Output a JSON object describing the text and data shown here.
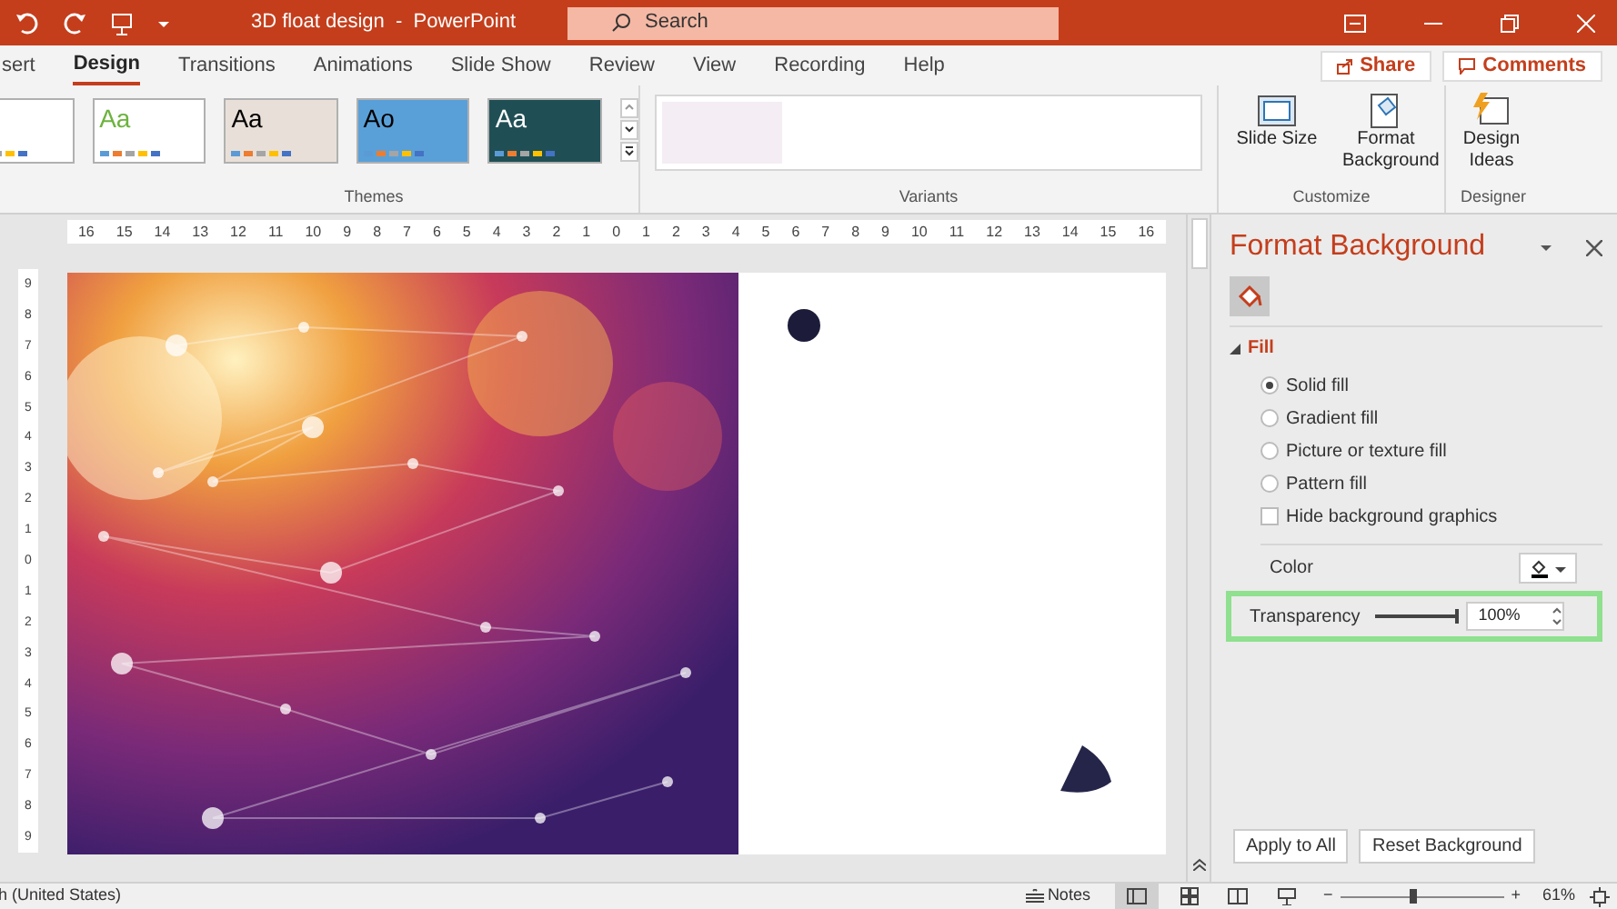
{
  "title_bar": {
    "title": "3D float design  -  PowerPoint",
    "search": {
      "placeholder": "Search"
    }
  },
  "tabs": [
    {
      "label": "sert",
      "selected": false
    },
    {
      "label": "Design",
      "selected": true
    },
    {
      "label": "Transitions",
      "selected": false
    },
    {
      "label": "Animations",
      "selected": false
    },
    {
      "label": "Slide Show",
      "selected": false
    },
    {
      "label": "Review",
      "selected": false
    },
    {
      "label": "View",
      "selected": false
    },
    {
      "label": "Recording",
      "selected": false
    },
    {
      "label": "Help",
      "selected": false
    }
  ],
  "share_button": "Share",
  "comments_button": "Comments",
  "themes": {
    "label": "Themes",
    "items": [
      {
        "color": "#ffffff",
        "selected": false
      },
      {
        "sample": "Aa",
        "color": "#ffffff",
        "selected": false
      },
      {
        "sample": "Aa",
        "color": "#e8e0d8",
        "selected": false
      },
      {
        "sample": "Ao",
        "color": "#5aa0d8",
        "selected": false
      },
      {
        "sample": "Aa",
        "color": "#1f4f55",
        "selected": false
      }
    ]
  },
  "variants": {
    "label": "Variants"
  },
  "customize": {
    "label": "Customize",
    "buttons": [
      "Slide Size",
      "Format Background"
    ]
  },
  "designer": {
    "label": "Designer",
    "buttons": [
      "Design Ideas"
    ]
  },
  "ruler": [
    "16",
    "15",
    "14",
    "13",
    "12",
    "11",
    "10",
    "9",
    "8",
    "7",
    "6",
    "5",
    "4",
    "3",
    "2",
    "1",
    "0",
    "1",
    "2",
    "3",
    "4",
    "5",
    "6",
    "7",
    "8",
    "9",
    "10",
    "11",
    "12",
    "13",
    "14",
    "15",
    "16"
  ],
  "vertical_ruler": [
    "9",
    "8",
    "7",
    "6",
    "5",
    "4",
    "3",
    "2",
    "1",
    "0",
    "1",
    "2",
    "3",
    "4",
    "5",
    "6",
    "7",
    "8",
    "9"
  ],
  "format_pane": {
    "title": "Format Background",
    "section": {
      "label": "Fill",
      "expanded": true
    },
    "options": [
      {
        "label": "Solid fill",
        "selected": true
      },
      {
        "label": "Gradient fill",
        "selected": false
      },
      {
        "label": "Picture or texture fill",
        "selected": false
      },
      {
        "label": "Pattern fill",
        "selected": false
      }
    ],
    "hide_graphics": {
      "label": "Hide background graphics",
      "checked": false
    },
    "color_label": "Color",
    "transparency": {
      "label": "Transparency",
      "level": 1,
      "value": "100%"
    },
    "buttons": [
      "Apply to All",
      "Reset Background"
    ]
  },
  "status_bar": {
    "language": "h (United States)",
    "notes": "Notes",
    "zoom_minus": "−",
    "zoom_plus": "+",
    "zoom": {
      "level": 0.45
    },
    "zoom_value": "61%"
  }
}
